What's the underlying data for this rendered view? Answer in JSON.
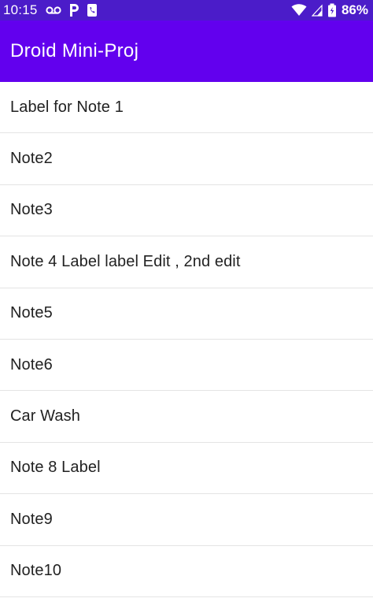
{
  "status_bar": {
    "time": "10:15",
    "battery_percent": "86%",
    "left_icons": [
      "voicemail-icon",
      "parking-icon",
      "phone-icon"
    ],
    "right_icons": [
      "wifi-icon",
      "signal-icon",
      "battery-icon"
    ]
  },
  "app_bar": {
    "title": "Droid Mini-Proj",
    "background_color": "#6200ee"
  },
  "status_bar_color": "#4b1cc9",
  "notes": [
    {
      "label": "Label for Note 1"
    },
    {
      "label": "Note2"
    },
    {
      "label": "Note3"
    },
    {
      "label": "Note 4 Label label Edit , 2nd edit"
    },
    {
      "label": "Note5"
    },
    {
      "label": "Note6"
    },
    {
      "label": "Car Wash"
    },
    {
      "label": "Note 8 Label"
    },
    {
      "label": "Note9"
    },
    {
      "label": "Note10"
    }
  ]
}
